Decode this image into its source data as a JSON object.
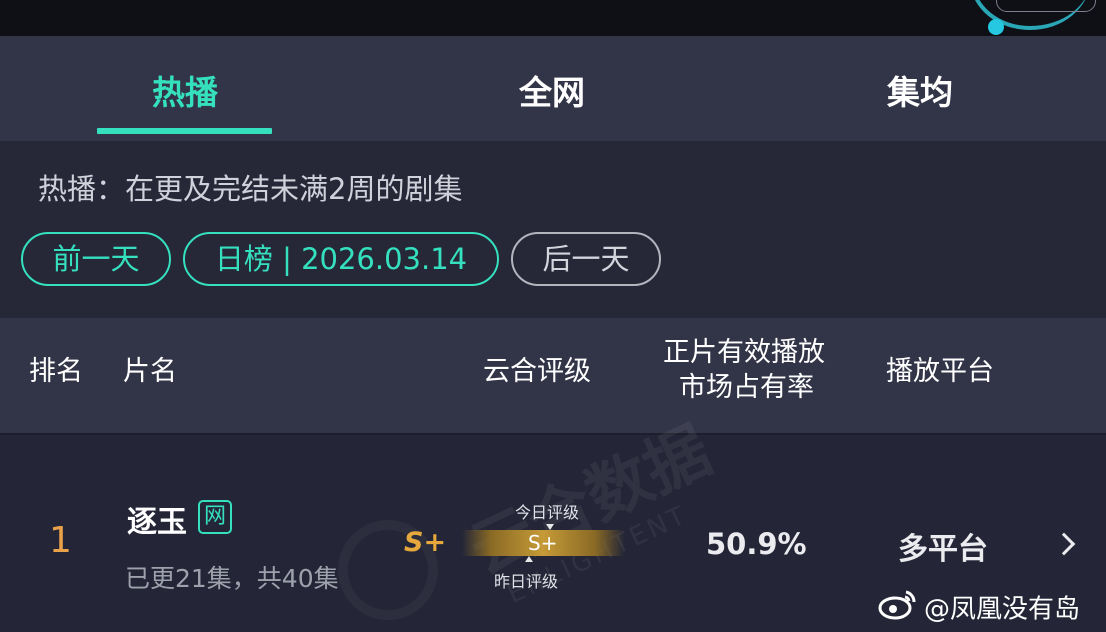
{
  "tabs": [
    {
      "label": "热播",
      "active": true
    },
    {
      "label": "全网",
      "active": false
    },
    {
      "label": "集均",
      "active": false
    }
  ],
  "filter": {
    "description": "热播：在更及完结未满2周的剧集",
    "prev_day": "前一天",
    "date_label": "日榜 | 2026.03.14",
    "next_day": "后一天"
  },
  "table": {
    "headers": {
      "rank": "排名",
      "name": "片名",
      "rating": "云合评级",
      "share_line1": "正片有效播放",
      "share_line2": "市场占有率",
      "platform": "播放平台"
    },
    "rows": [
      {
        "rank": "1",
        "title": "逐玉",
        "badge": "网",
        "episodes": "已更21集，共40集",
        "rating": "S+",
        "today_label": "今日评级",
        "bar_rating": "S+",
        "yesterday_label": "昨日评级",
        "share": "50.9%",
        "platform": "多平台"
      }
    ]
  },
  "watermark": {
    "text": "云合数据",
    "sub": "ENLIGHTENT"
  },
  "weibo_handle": "@凤凰没有岛",
  "colors": {
    "accent": "#35e0bf",
    "rank": "#e9a24a",
    "rating": "#e6a83c"
  }
}
